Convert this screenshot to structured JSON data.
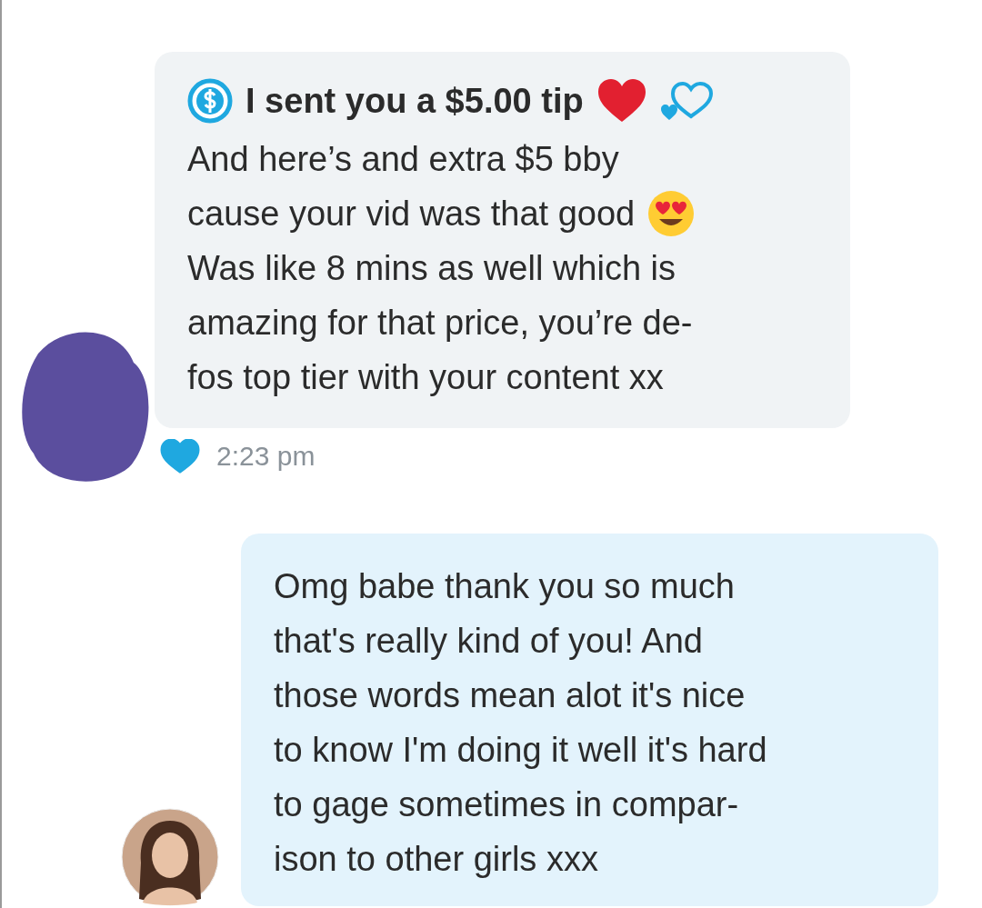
{
  "messages": [
    {
      "kind": "incoming",
      "tip": {
        "text": "I sent you a $5.00 tip"
      },
      "lines": [
        {
          "kind": "plain",
          "text": "And here’s and extra $5 bby"
        },
        {
          "kind": "emoji",
          "text": "cause your vid was that good"
        },
        {
          "kind": "plain",
          "text": "Was like 8 mins as well which is"
        },
        {
          "kind": "plain",
          "text": "amazing for that price, you’re de-"
        },
        {
          "kind": "plain",
          "text": "fos top tier with your content xx"
        }
      ],
      "liked": true,
      "time": "2:23 pm"
    },
    {
      "kind": "outgoing",
      "lines": [
        {
          "kind": "plain",
          "text": "Omg babe thank you so much"
        },
        {
          "kind": "plain",
          "text": "that's really kind of you! And"
        },
        {
          "kind": "plain",
          "text": "those words mean alot it's nice"
        },
        {
          "kind": "plain",
          "text": "to know I'm doing it well it's hard"
        },
        {
          "kind": "plain",
          "text": "to gage sometimes in compar-"
        },
        {
          "kind": "plain",
          "text": "ison to other girls xxx"
        }
      ]
    }
  ]
}
